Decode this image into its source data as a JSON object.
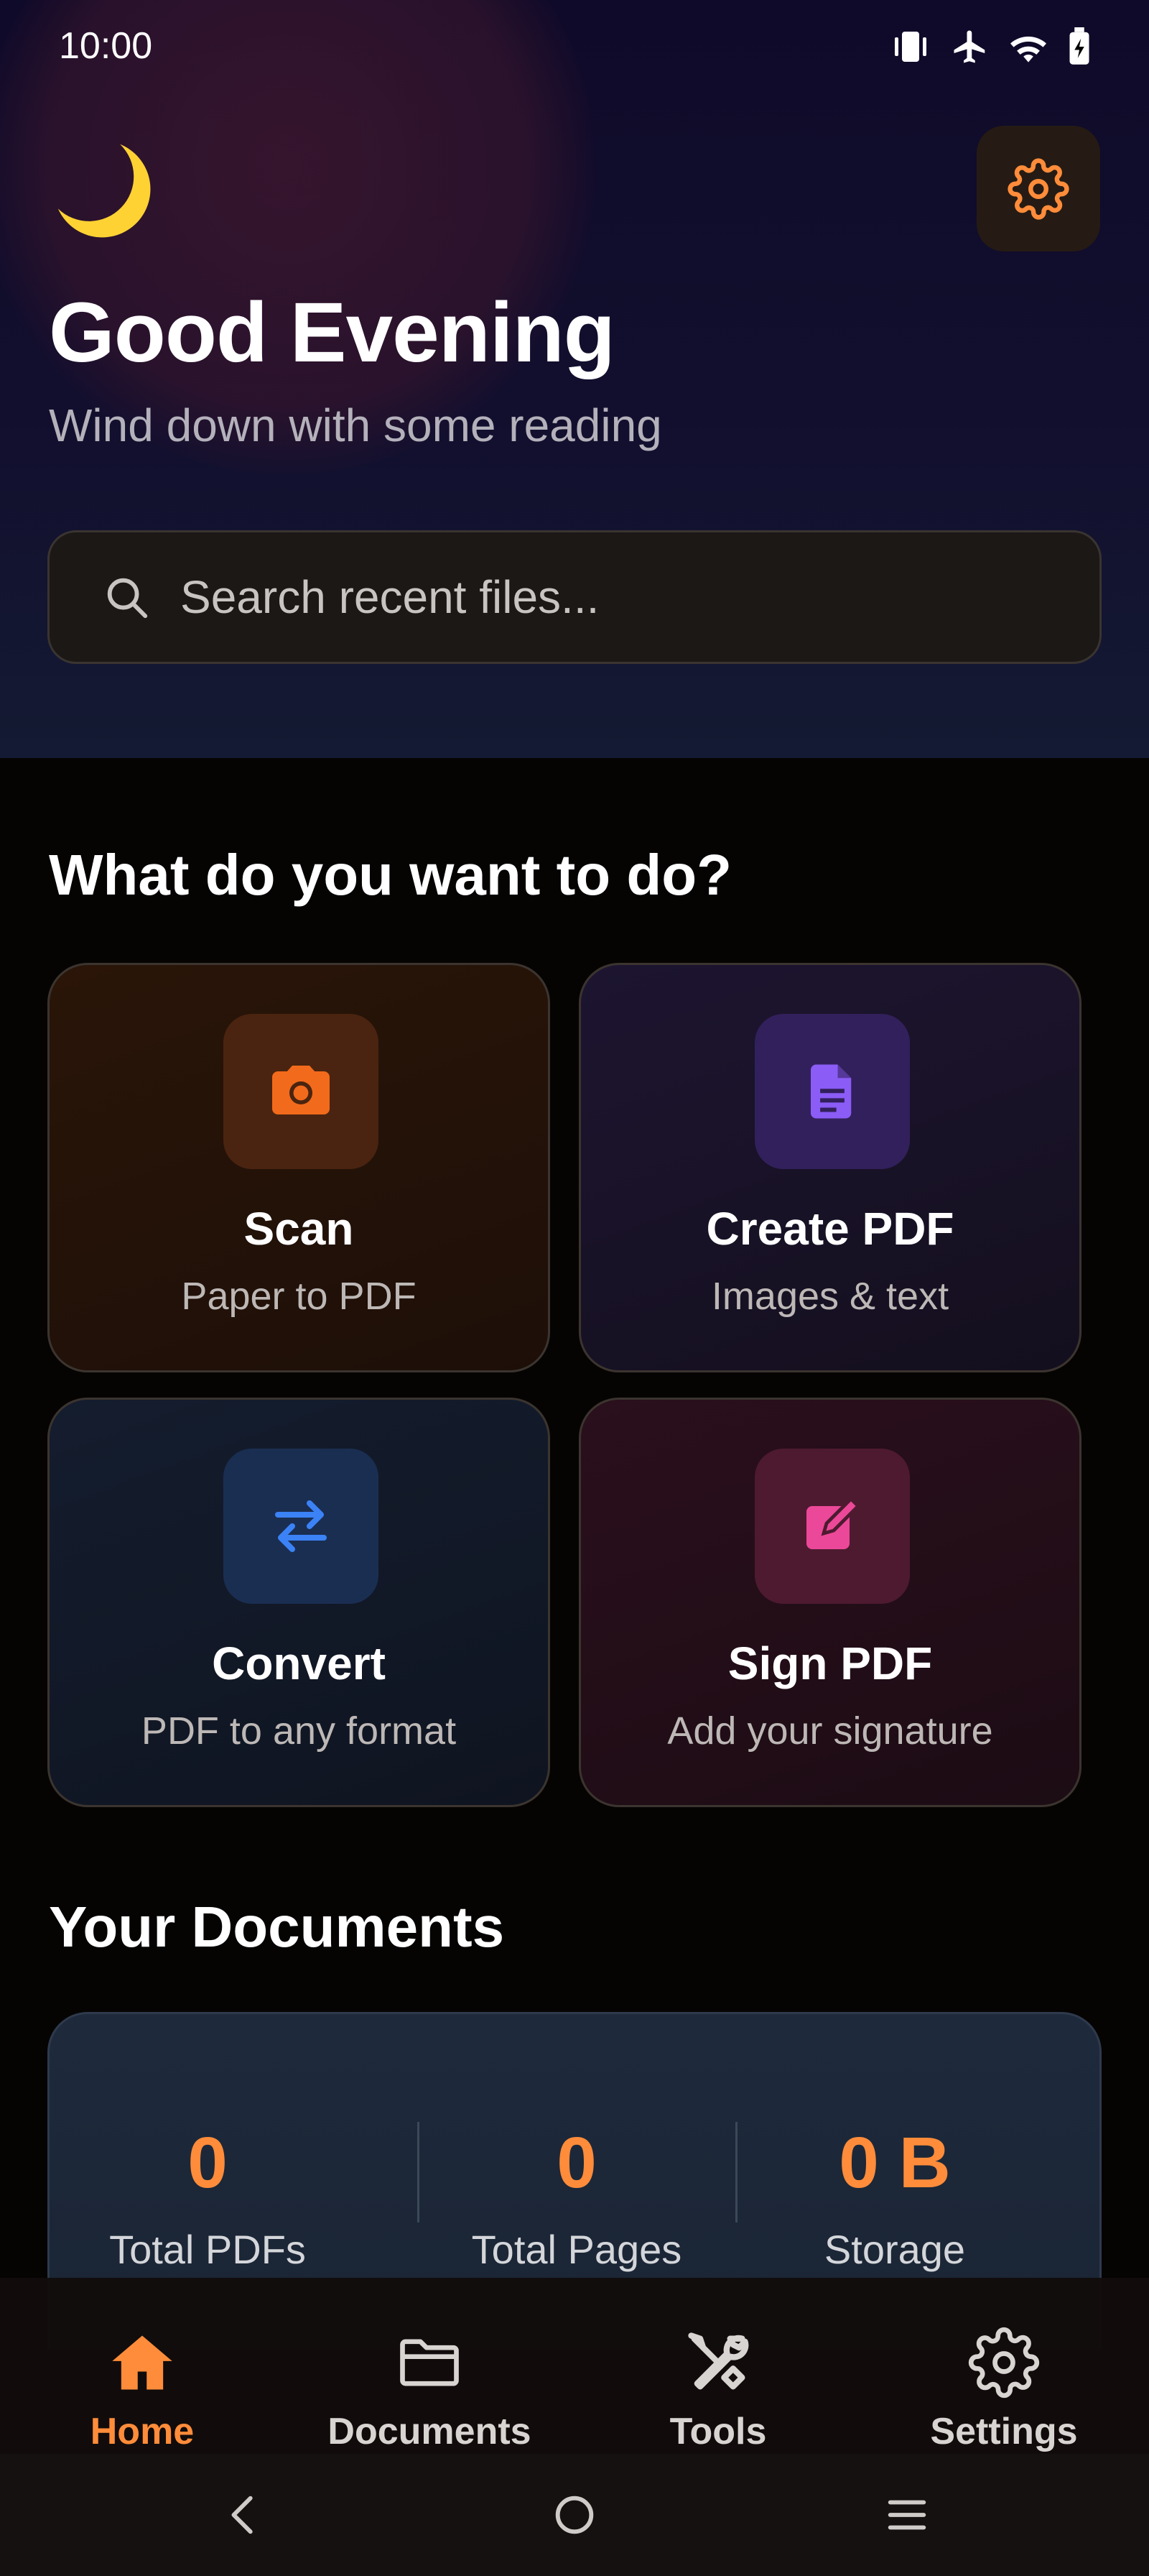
{
  "status_bar": {
    "time": "10:00"
  },
  "greeting": {
    "title": "Good Evening",
    "subtitle": "Wind down with some reading"
  },
  "search": {
    "placeholder": "Search recent files...",
    "value": ""
  },
  "actions": {
    "title": "What do you want to do?",
    "items": [
      {
        "title": "Scan",
        "subtitle": "Paper to PDF",
        "icon": "camera-icon",
        "color": "#f26a1b"
      },
      {
        "title": "Create PDF",
        "subtitle": "Images & text",
        "icon": "document-icon",
        "color": "#8b5cf6"
      },
      {
        "title": "Convert",
        "subtitle": "PDF to any format",
        "icon": "swap-arrows-icon",
        "color": "#3b82f6"
      },
      {
        "title": "Sign PDF",
        "subtitle": "Add your signature",
        "icon": "edit-square-icon",
        "color": "#ec4899"
      }
    ]
  },
  "documents": {
    "title": "Your Documents",
    "stats": [
      {
        "value": "0",
        "label": "Total PDFs"
      },
      {
        "value": "0",
        "label": "Total Pages"
      },
      {
        "value": "0 B",
        "label": "Storage"
      }
    ]
  },
  "bottom_nav": {
    "items": [
      {
        "label": "Home",
        "icon": "home-icon",
        "active": true
      },
      {
        "label": "Documents",
        "icon": "folder-icon",
        "active": false
      },
      {
        "label": "Tools",
        "icon": "tools-icon",
        "active": false
      },
      {
        "label": "Settings",
        "icon": "gear-icon",
        "active": false
      }
    ]
  },
  "colors": {
    "accent": "#ff8c3a",
    "background": "#060403",
    "header": "#0f0a29"
  }
}
